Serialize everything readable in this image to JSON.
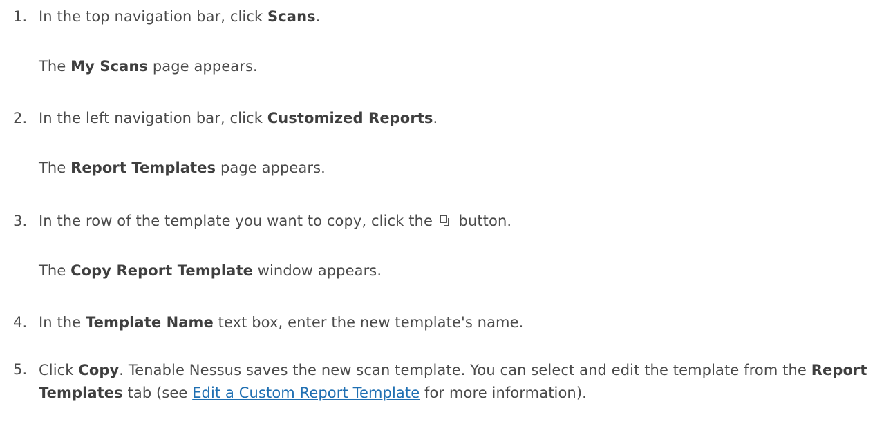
{
  "steps": [
    {
      "number": "1.",
      "pre": "In the top navigation bar, click ",
      "bold": "Scans",
      "post": ".",
      "result": {
        "pre": "The ",
        "bold": "My Scans",
        "post": " page appears."
      }
    },
    {
      "number": "2.",
      "pre": "In the left navigation bar, click ",
      "bold": "Customized Reports",
      "post": ".",
      "result": {
        "pre": "The ",
        "bold": "Report Templates",
        "post": " page appears."
      }
    },
    {
      "number": "3.",
      "pre": "In the row of the template you want to copy, click the ",
      "icon": "copy-icon",
      "post": " button.",
      "result": {
        "pre": "The ",
        "bold": "Copy Report Template",
        "post": " window appears."
      }
    },
    {
      "number": "4.",
      "pre": "In the ",
      "bold": "Template Name",
      "post": " text box, enter the new template's name."
    },
    {
      "number": "5.",
      "pre": "Click ",
      "bold": "Copy",
      "mid": ". Tenable Nessus saves the new scan template. You can select and edit the template from the ",
      "bold2": "Report Templates",
      "mid2": " tab (see ",
      "link": "Edit a Custom Report Template",
      "post": " for more information)."
    }
  ]
}
